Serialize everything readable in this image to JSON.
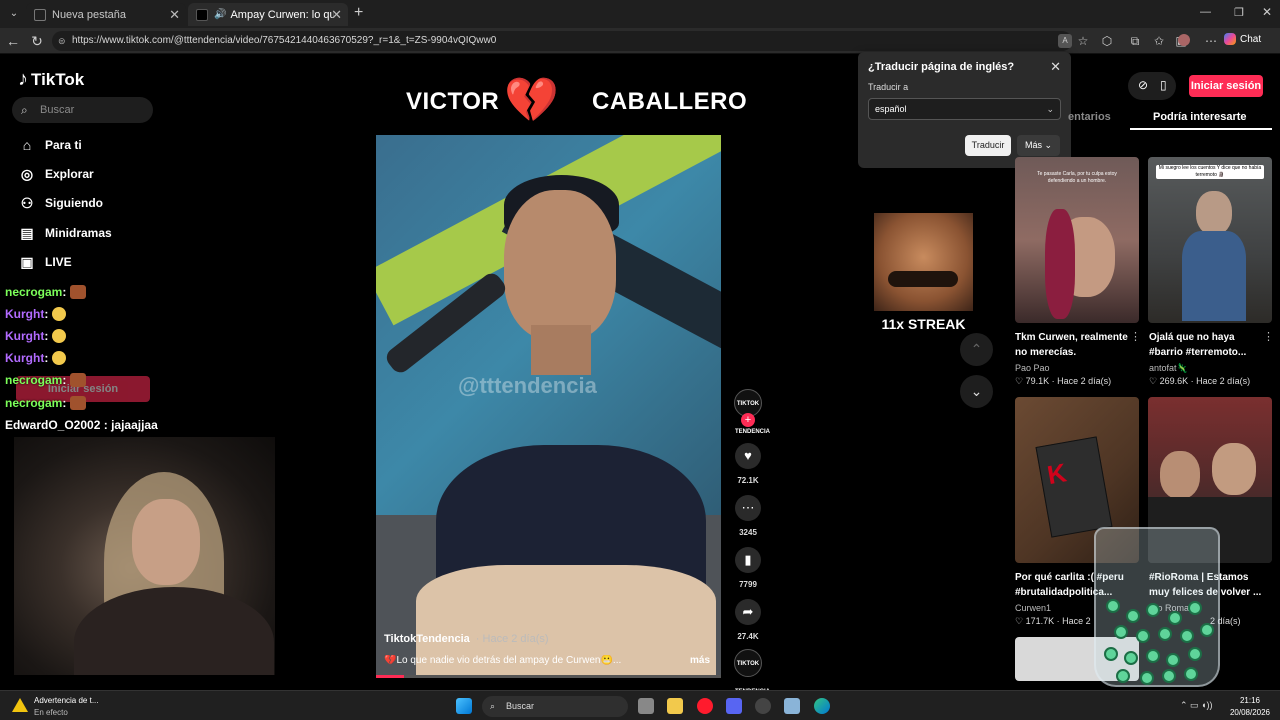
{
  "browser": {
    "tabs": [
      {
        "label": "Nueva pestaña"
      },
      {
        "label": "Ampay Curwen: lo que nadie"
      }
    ],
    "new_tab_icon": "plus-icon",
    "url": "https://www.tiktok.com/@tttendencia/video/7675421440463670529?_r=1&_t=ZS-9904vQIQww0",
    "chat_label": "Chat"
  },
  "translate_popup": {
    "title": "¿Traducir página de inglés?",
    "subtitle": "Traducir a",
    "selected_language": "español",
    "translate_button": "Traducir",
    "more_button": "Más"
  },
  "sidebar": {
    "logo": "TikTok",
    "search_placeholder": "Buscar",
    "items": [
      {
        "label": "Para ti",
        "icon": "home-icon"
      },
      {
        "label": "Explorar",
        "icon": "compass-icon"
      },
      {
        "label": "Siguiendo",
        "icon": "user-icon"
      },
      {
        "label": "Minidramas",
        "icon": "film-icon"
      },
      {
        "label": "LIVE",
        "icon": "tv-icon"
      }
    ],
    "login_ghost": "Iniciar sesión"
  },
  "chat": [
    {
      "user": "necrogam",
      "message": "",
      "color": "#7cff5a"
    },
    {
      "user": "Kurght",
      "message": "",
      "color": "#b26bff"
    },
    {
      "user": "Kurght",
      "message": "",
      "color": "#b26bff"
    },
    {
      "user": "Kurght",
      "message": "",
      "color": "#b26bff"
    },
    {
      "user": "necrogam",
      "message": "",
      "color": "#7cff5a"
    },
    {
      "user": "necrogam",
      "message": "",
      "color": "#7cff5a"
    },
    {
      "user": "EdwardO_O2002",
      "message": "jajaajjaa",
      "color": "#ffffff"
    }
  ],
  "video": {
    "header_left": "VICTOR",
    "header_right": "CABALLERO",
    "watermark": "@tttendencia",
    "author": "TiktokTendencia",
    "time": "· Hace 2 día(s)",
    "caption": "💔Lo que nadie vio detrás del ampay de Curwen😬...",
    "more": "más",
    "progress": 0.08
  },
  "actions": {
    "avatar_label": "TIKTOK TENDENCIA",
    "likes": "72.1K",
    "comments": "3245",
    "saves": "7799",
    "shares": "27.4K"
  },
  "streak": {
    "text": "11x STREAK"
  },
  "right_panel": {
    "login": "Iniciar sesión",
    "tab_comments": "entarios",
    "tab_interest": "Podría interesarte",
    "cards": [
      {
        "title": "Tkm Curwen, realmente no merecías.",
        "author": "Pao Pao",
        "views": "79.1K",
        "time": "Hace 2 día(s)",
        "thumb_caption": "Te pasaste Carla, por tu culpa estoy defendiendo a un hombre."
      },
      {
        "title": "Ojalá que no haya #barrio #terremoto...",
        "author": "antofat🦎",
        "views": "269.6K",
        "time": "Hace 2 día(s)",
        "thumb_caption": "Mi suegro lee los cuentos Y dice que no había terremoto 🗿"
      },
      {
        "title": "Por qué carlita :( #peru #brutalidadpolitica...",
        "author": "Curwen1",
        "views": "171.7K",
        "time": "Hace 2",
        "thumb_caption": ""
      },
      {
        "title": "#RioRoma | Estamos muy felices de volver ...",
        "author": "Rio Roma",
        "views": "",
        "time": "2 día(s)",
        "thumb_caption": ""
      }
    ]
  },
  "taskbar": {
    "weather_title": "Advertencia de t...",
    "weather_sub": "En efecto",
    "search": "Buscar",
    "time": "21:16",
    "date": "20/08/2026"
  }
}
